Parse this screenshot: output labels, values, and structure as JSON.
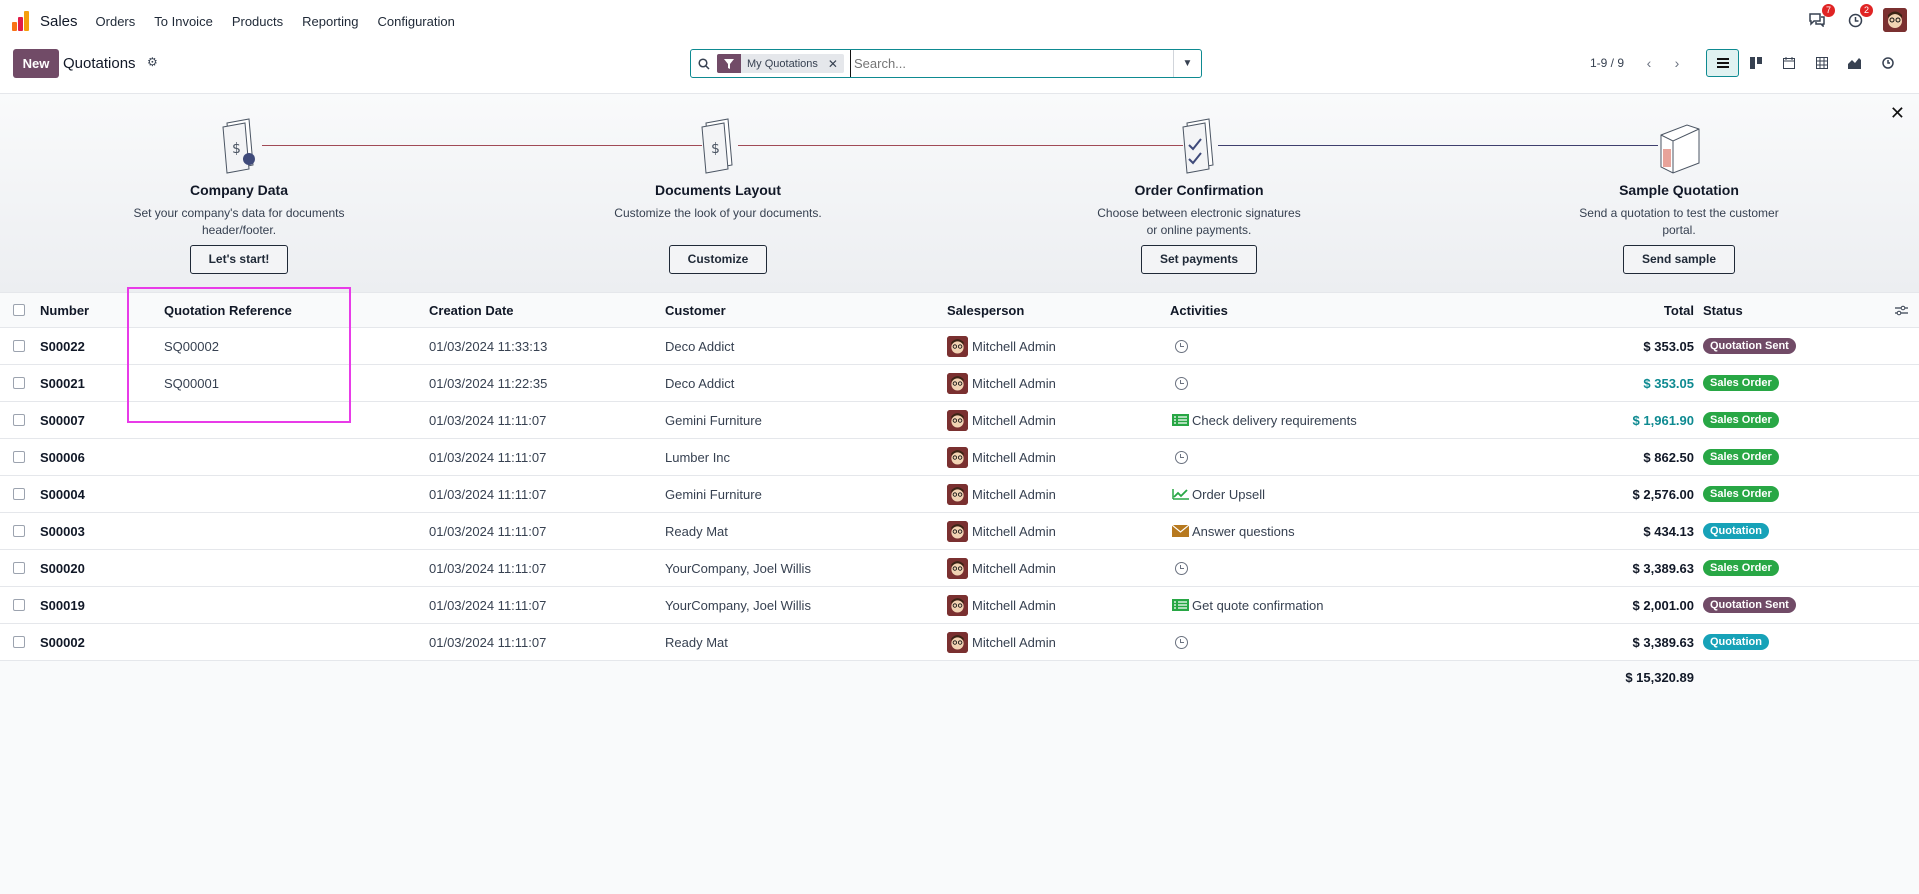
{
  "app": {
    "name": "Sales"
  },
  "nav": {
    "items": [
      "Orders",
      "To Invoice",
      "Products",
      "Reporting",
      "Configuration"
    ]
  },
  "notifications": {
    "messages_count": "7",
    "activities_count": "2"
  },
  "control": {
    "new_label": "New",
    "title": "Quotations",
    "facet_label": "My Quotations",
    "search_placeholder": "Search...",
    "pager": "1-9 / 9"
  },
  "onboarding": {
    "steps": [
      {
        "title": "Company Data",
        "desc": "Set your company's data for documents header/footer.",
        "button": "Let's start!"
      },
      {
        "title": "Documents Layout",
        "desc": "Customize the look of your documents.",
        "button": "Customize"
      },
      {
        "title": "Order Confirmation",
        "desc": "Choose between electronic signatures or online payments.",
        "button": "Set payments"
      },
      {
        "title": "Sample Quotation",
        "desc": "Send a quotation to test the customer portal.",
        "button": "Send sample"
      }
    ]
  },
  "table": {
    "headers": {
      "number": "Number",
      "reference": "Quotation Reference",
      "date": "Creation Date",
      "customer": "Customer",
      "salesperson": "Salesperson",
      "activities": "Activities",
      "total": "Total",
      "status": "Status"
    },
    "rows": [
      {
        "number": "S00022",
        "reference": "SQ00002",
        "date": "01/03/2024 11:33:13",
        "customer": "Deco Addict",
        "salesperson": "Mitchell Admin",
        "activity": "",
        "activity_icon": "clock",
        "total": "$ 353.05",
        "total_teal": false,
        "status": "Quotation Sent"
      },
      {
        "number": "S00021",
        "reference": "SQ00001",
        "date": "01/03/2024 11:22:35",
        "customer": "Deco Addict",
        "salesperson": "Mitchell Admin",
        "activity": "",
        "activity_icon": "clock",
        "total": "$ 353.05",
        "total_teal": true,
        "status": "Sales Order"
      },
      {
        "number": "S00007",
        "reference": "",
        "date": "01/03/2024 11:11:07",
        "customer": "Gemini Furniture",
        "salesperson": "Mitchell Admin",
        "activity": "Check delivery requirements",
        "activity_icon": "list",
        "total": "$ 1,961.90",
        "total_teal": true,
        "status": "Sales Order"
      },
      {
        "number": "S00006",
        "reference": "",
        "date": "01/03/2024 11:11:07",
        "customer": "Lumber Inc",
        "salesperson": "Mitchell Admin",
        "activity": "",
        "activity_icon": "clock",
        "total": "$ 862.50",
        "total_teal": false,
        "status": "Sales Order"
      },
      {
        "number": "S00004",
        "reference": "",
        "date": "01/03/2024 11:11:07",
        "customer": "Gemini Furniture",
        "salesperson": "Mitchell Admin",
        "activity": "Order Upsell",
        "activity_icon": "chart",
        "total": "$ 2,576.00",
        "total_teal": false,
        "status": "Sales Order"
      },
      {
        "number": "S00003",
        "reference": "",
        "date": "01/03/2024 11:11:07",
        "customer": "Ready Mat",
        "salesperson": "Mitchell Admin",
        "activity": "Answer questions",
        "activity_icon": "mail",
        "total": "$ 434.13",
        "total_teal": false,
        "status": "Quotation"
      },
      {
        "number": "S00020",
        "reference": "",
        "date": "01/03/2024 11:11:07",
        "customer": "YourCompany, Joel Willis",
        "salesperson": "Mitchell Admin",
        "activity": "",
        "activity_icon": "clock",
        "total": "$ 3,389.63",
        "total_teal": false,
        "status": "Sales Order"
      },
      {
        "number": "S00019",
        "reference": "",
        "date": "01/03/2024 11:11:07",
        "customer": "YourCompany, Joel Willis",
        "salesperson": "Mitchell Admin",
        "activity": "Get quote confirmation",
        "activity_icon": "list",
        "total": "$ 2,001.00",
        "total_teal": false,
        "status": "Quotation Sent"
      },
      {
        "number": "S00002",
        "reference": "",
        "date": "01/03/2024 11:11:07",
        "customer": "Ready Mat",
        "salesperson": "Mitchell Admin",
        "activity": "",
        "activity_icon": "clock",
        "total": "$ 3,389.63",
        "total_teal": false,
        "status": "Quotation"
      }
    ],
    "sum_total": "$ 15,320.89"
  },
  "colors": {
    "Quotation Sent": "#714b67",
    "Sales Order": "#28a745",
    "Quotation": "#17a2b8"
  }
}
